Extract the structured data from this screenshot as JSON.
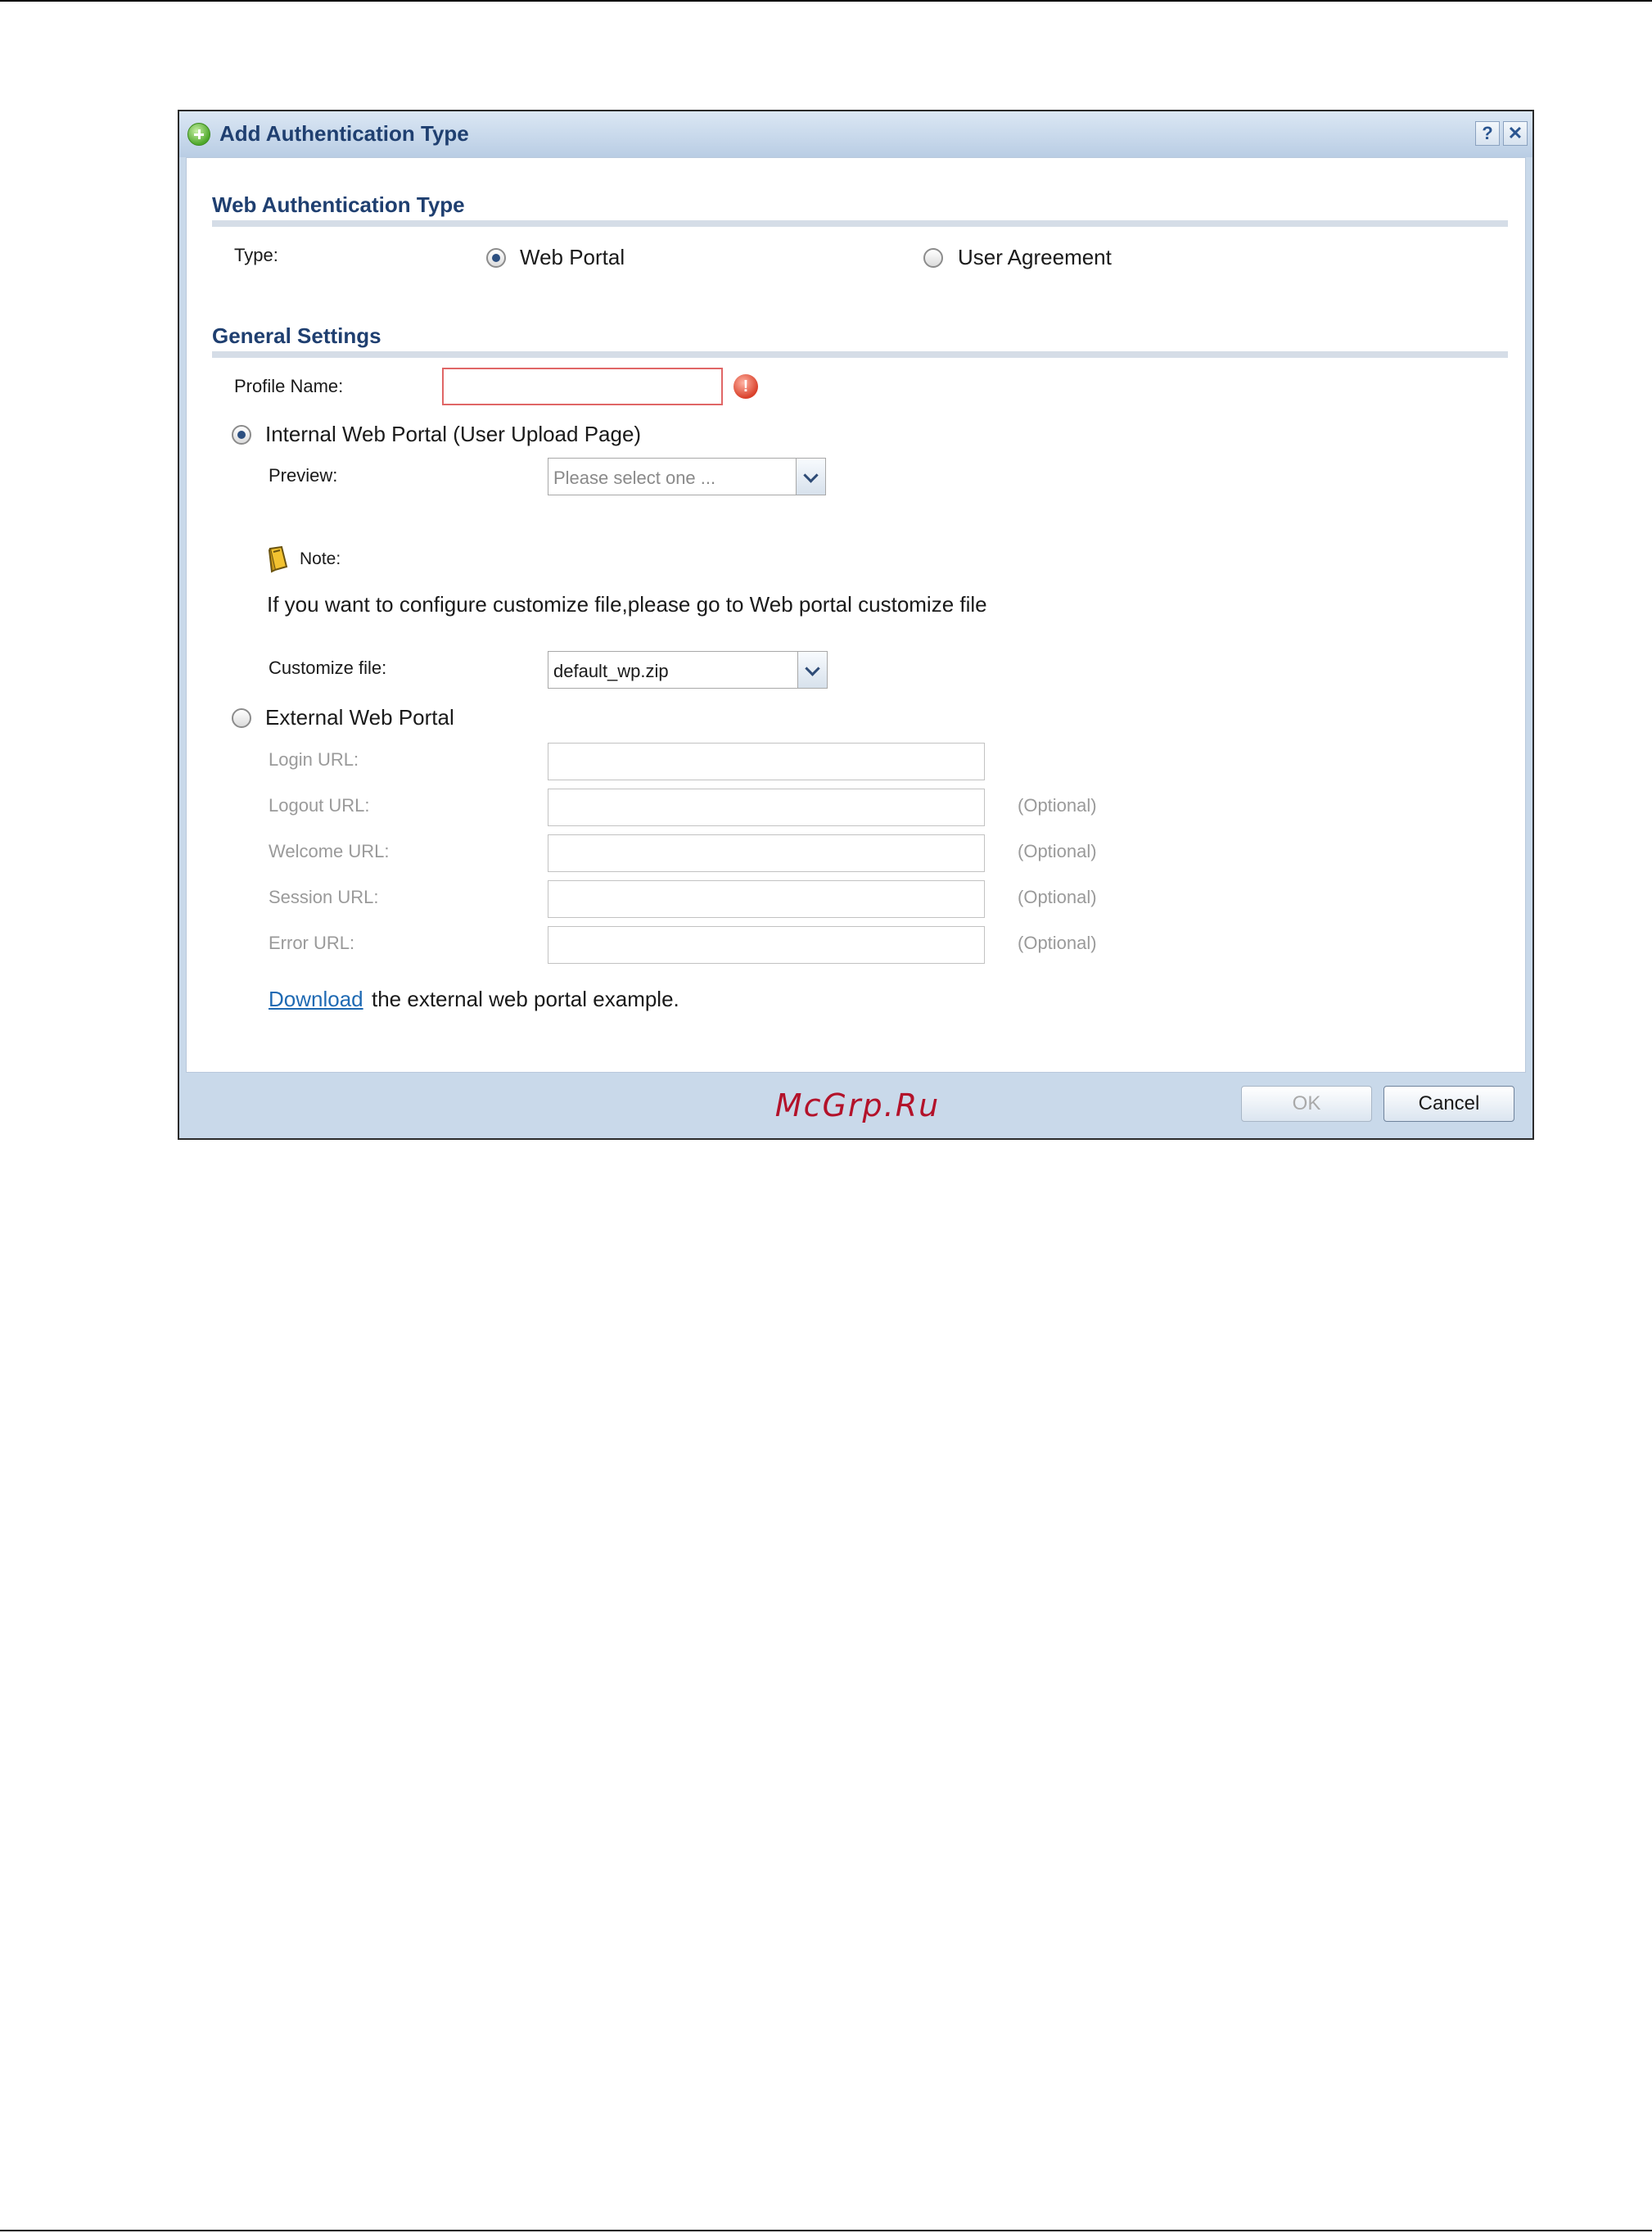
{
  "dialog": {
    "title": "Add Authentication Type",
    "help_label": "?",
    "close_label": "✕"
  },
  "web_auth": {
    "section_title": "Web Authentication Type",
    "type_label": "Type:",
    "options": [
      {
        "label": "Web Portal",
        "checked": true
      },
      {
        "label": "User Agreement",
        "checked": false
      }
    ]
  },
  "general": {
    "section_title": "General Settings",
    "profile_name_label": "Profile Name:",
    "profile_name_value": "",
    "internal": {
      "label": "Internal Web Portal (User Upload Page)",
      "checked": true,
      "preview_label": "Preview:",
      "preview_placeholder": "Please select one ...",
      "note_label": "Note:",
      "note_text": "If you want to configure customize file,please go to Web portal customize file",
      "customize_label": "Customize file:",
      "customize_value": "default_wp.zip"
    },
    "external": {
      "label": "External Web Portal",
      "checked": false,
      "fields": [
        {
          "label": "Login URL:",
          "value": "",
          "suffix": ""
        },
        {
          "label": "Logout URL:",
          "value": "",
          "suffix": "(Optional)"
        },
        {
          "label": "Welcome URL:",
          "value": "",
          "suffix": "(Optional)"
        },
        {
          "label": "Session URL:",
          "value": "",
          "suffix": "(Optional)"
        },
        {
          "label": "Error URL:",
          "value": "",
          "suffix": "(Optional)"
        }
      ],
      "download_link": "Download",
      "download_text": "the external web portal example."
    }
  },
  "footer": {
    "watermark": "McGrp.Ru",
    "ok_label": "OK",
    "cancel_label": "Cancel"
  },
  "colors": {
    "accent": "#1f3f70",
    "link": "#1f6ab3",
    "error": "#e06666",
    "watermark": "#b3122a"
  }
}
